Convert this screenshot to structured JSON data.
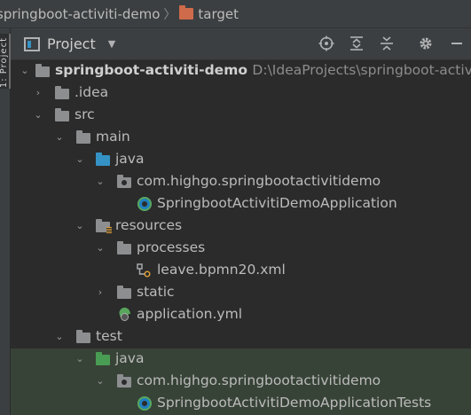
{
  "breadcrumb": {
    "project": "springboot-activiti-demo",
    "separator": "〉",
    "folder": "target"
  },
  "side_strip": {
    "tab_label": "1: Project"
  },
  "toolbar": {
    "title": "Project",
    "dropdown_glyph": "▼",
    "icons": [
      "locate-icon",
      "expand-all-icon",
      "collapse-all-icon",
      "gear-icon",
      "hide-icon"
    ]
  },
  "tree": {
    "root": {
      "label": "springboot-activiti-demo",
      "path": "D:\\IdeaProjects\\springboot-activiti"
    },
    "idea": ".idea",
    "src": "src",
    "main": "main",
    "java_main": "java",
    "pkg_main": "com.highgo.springbootactivitidemo",
    "app_class": "SpringbootActivitiDemoApplication",
    "resources": "resources",
    "processes": "processes",
    "bpmn_file": "leave.bpmn20.xml",
    "static": "static",
    "yml_file": "application.yml",
    "test": "test",
    "java_test": "java",
    "pkg_test": "com.highgo.springbootactivitidemo",
    "test_class": "SpringbootActivitiDemoApplicationTests"
  },
  "colors": {
    "background": "#2b2b2b",
    "panel": "#3c3f41",
    "source_folder": "#3592c4",
    "test_folder": "#499c54",
    "highlight_row": "#384337",
    "target_folder": "#cf6a4a"
  }
}
